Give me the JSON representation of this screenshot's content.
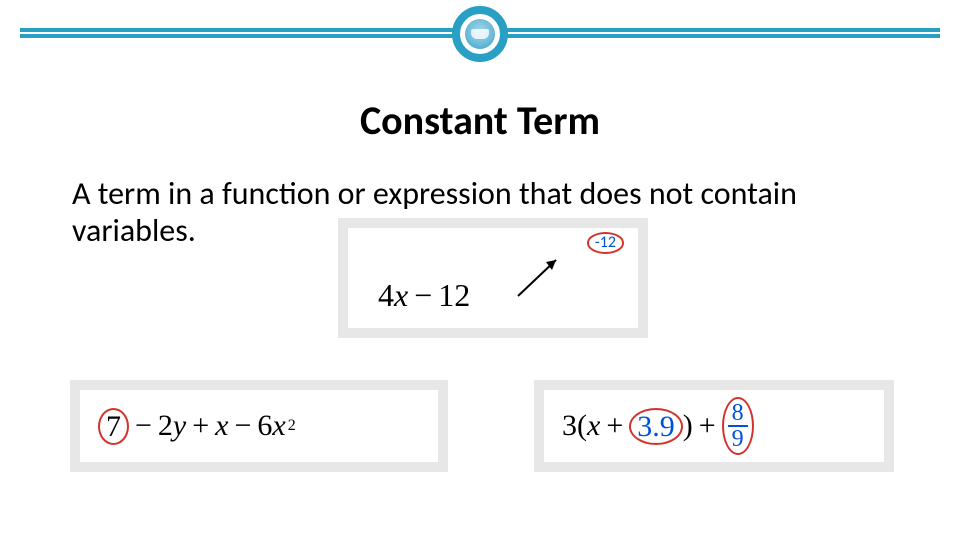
{
  "header": {
    "logo_name": "school-logo"
  },
  "title": "Constant Term",
  "definition": "A term in a function or expression that does not contain variables.",
  "examples": {
    "ex1": {
      "expr_a": "4",
      "expr_var": "x",
      "expr_op": "−",
      "expr_b": "12",
      "callout": "-12"
    },
    "ex2": {
      "const": "7",
      "t1_op": "−",
      "t1_coef": "2",
      "t1_var": "y",
      "t2_op": "+",
      "t2_var": "x",
      "t3_op": "−",
      "t3_coef": "6",
      "t3_var": "x",
      "t3_exp": "2"
    },
    "ex3": {
      "lead_coef": "3",
      "lparen": "(",
      "inner_var": "x",
      "inner_op": "+",
      "inner_const": "3.9",
      "rparen": ")",
      "plus": "+",
      "frac_num": "8",
      "frac_den": "9"
    }
  }
}
